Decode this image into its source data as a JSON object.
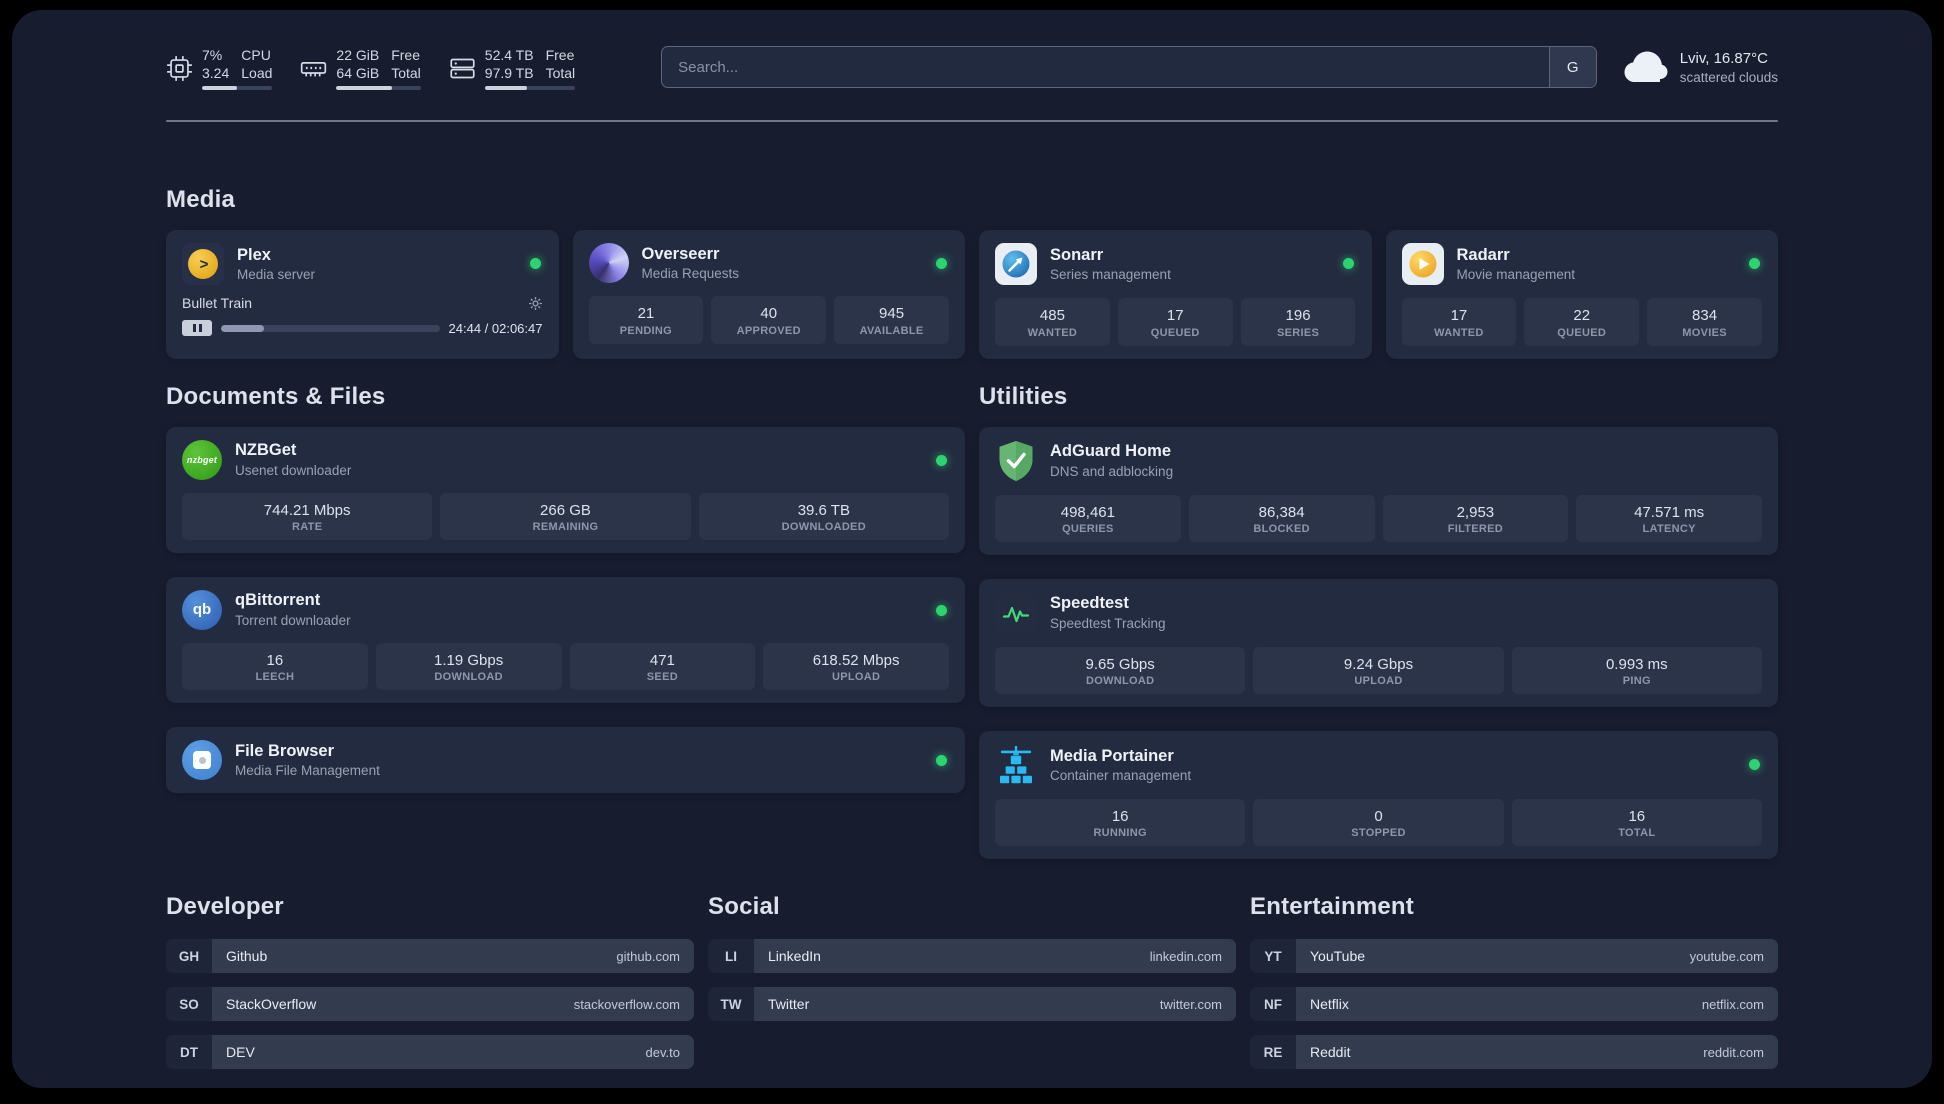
{
  "colors": {
    "background": "#171d2f",
    "card": "#232b40",
    "stat_tile": "#2c3449",
    "bookmark_pill": "#333b4f",
    "status_online": "#2dd36f",
    "plex_gold": "#e5a00d",
    "sonarr_blue": "#1e9ce3",
    "radarr_amber": "#f0a92e",
    "nzbget_green": "#3fae2a",
    "qbittorrent_blue": "#3a6fc4",
    "filebrowser_blue": "#4e94e0",
    "adguard_green": "#5fb760",
    "speedtest_green": "#43d97b",
    "portainer_blue": "#2cb8f0"
  },
  "topbar": {
    "resources": [
      {
        "name": "cpu",
        "col1_top": "7%",
        "col1_bottom": "3.24",
        "col2_top": "CPU",
        "col2_bottom": "Load",
        "progress_percent": 50
      },
      {
        "name": "memory",
        "col1_top": "22 GiB",
        "col1_bottom": "64 GiB",
        "col2_top": "Free",
        "col2_bottom": "Total",
        "progress_percent": 66
      },
      {
        "name": "disk",
        "col1_top": "52.4 TB",
        "col1_bottom": "97.9 TB",
        "col2_top": "Free",
        "col2_bottom": "Total",
        "progress_percent": 47
      }
    ],
    "search": {
      "placeholder": "Search...",
      "provider_button": "G"
    },
    "weather": {
      "location": "Lviv, 16.87°C",
      "condition": "scattered clouds"
    }
  },
  "sections": {
    "media": {
      "title": "Media",
      "cards": {
        "plex": {
          "title": "Plex",
          "subtitle": "Media server",
          "status": "online",
          "now_playing": {
            "title": "Bullet Train",
            "time": "24:44 / 02:06:47",
            "progress_percent": 19.5
          }
        },
        "overseerr": {
          "title": "Overseerr",
          "subtitle": "Media Requests",
          "status": "online",
          "stats": [
            {
              "value": "21",
              "label": "PENDING"
            },
            {
              "value": "40",
              "label": "APPROVED"
            },
            {
              "value": "945",
              "label": "AVAILABLE"
            }
          ]
        },
        "sonarr": {
          "title": "Sonarr",
          "subtitle": "Series management",
          "status": "online",
          "stats": [
            {
              "value": "485",
              "label": "WANTED"
            },
            {
              "value": "17",
              "label": "QUEUED"
            },
            {
              "value": "196",
              "label": "SERIES"
            }
          ]
        },
        "radarr": {
          "title": "Radarr",
          "subtitle": "Movie management",
          "status": "online",
          "stats": [
            {
              "value": "17",
              "label": "WANTED"
            },
            {
              "value": "22",
              "label": "QUEUED"
            },
            {
              "value": "834",
              "label": "MOVIES"
            }
          ]
        }
      }
    },
    "documents": {
      "title": "Documents & Files",
      "cards": {
        "nzbget": {
          "title": "NZBGet",
          "subtitle": "Usenet downloader",
          "status": "online",
          "stats": [
            {
              "value": "744.21 Mbps",
              "label": "RATE"
            },
            {
              "value": "266 GB",
              "label": "REMAINING"
            },
            {
              "value": "39.6 TB",
              "label": "DOWNLOADED"
            }
          ]
        },
        "qbittorrent": {
          "title": "qBittorrent",
          "subtitle": "Torrent downloader",
          "status": "online",
          "stats": [
            {
              "value": "16",
              "label": "LEECH"
            },
            {
              "value": "1.19 Gbps",
              "label": "DOWNLOAD"
            },
            {
              "value": "471",
              "label": "SEED"
            },
            {
              "value": "618.52 Mbps",
              "label": "UPLOAD"
            }
          ]
        },
        "filebrowser": {
          "title": "File Browser",
          "subtitle": "Media File Management",
          "status": "online"
        }
      }
    },
    "utilities": {
      "title": "Utilities",
      "cards": {
        "adguard": {
          "title": "AdGuard Home",
          "subtitle": "DNS and adblocking",
          "stats": [
            {
              "value": "498,461",
              "label": "QUERIES"
            },
            {
              "value": "86,384",
              "label": "BLOCKED"
            },
            {
              "value": "2,953",
              "label": "FILTERED"
            },
            {
              "value": "47.571 ms",
              "label": "LATENCY"
            }
          ]
        },
        "speedtest": {
          "title": "Speedtest",
          "subtitle": "Speedtest Tracking",
          "stats": [
            {
              "value": "9.65 Gbps",
              "label": "DOWNLOAD"
            },
            {
              "value": "9.24 Gbps",
              "label": "UPLOAD"
            },
            {
              "value": "0.993 ms",
              "label": "PING"
            }
          ]
        },
        "portainer": {
          "title": "Media Portainer",
          "subtitle": "Container management",
          "status": "online",
          "stats": [
            {
              "value": "16",
              "label": "RUNNING"
            },
            {
              "value": "0",
              "label": "STOPPED"
            },
            {
              "value": "16",
              "label": "TOTAL"
            }
          ]
        }
      }
    }
  },
  "bookmarks": {
    "developer": {
      "title": "Developer",
      "items": [
        {
          "abbr": "GH",
          "name": "Github",
          "domain": "github.com"
        },
        {
          "abbr": "SO",
          "name": "StackOverflow",
          "domain": "stackoverflow.com"
        },
        {
          "abbr": "DT",
          "name": "DEV",
          "domain": "dev.to"
        }
      ]
    },
    "social": {
      "title": "Social",
      "items": [
        {
          "abbr": "LI",
          "name": "LinkedIn",
          "domain": "linkedin.com"
        },
        {
          "abbr": "TW",
          "name": "Twitter",
          "domain": "twitter.com"
        }
      ]
    },
    "entertainment": {
      "title": "Entertainment",
      "items": [
        {
          "abbr": "YT",
          "name": "YouTube",
          "domain": "youtube.com"
        },
        {
          "abbr": "NF",
          "name": "Netflix",
          "domain": "netflix.com"
        },
        {
          "abbr": "RE",
          "name": "Reddit",
          "domain": "reddit.com"
        }
      ]
    }
  },
  "icons": {
    "nzbget_logo_text": "nzbget",
    "qbittorrent_logo_text": "qb",
    "plex_chevron": ">"
  }
}
